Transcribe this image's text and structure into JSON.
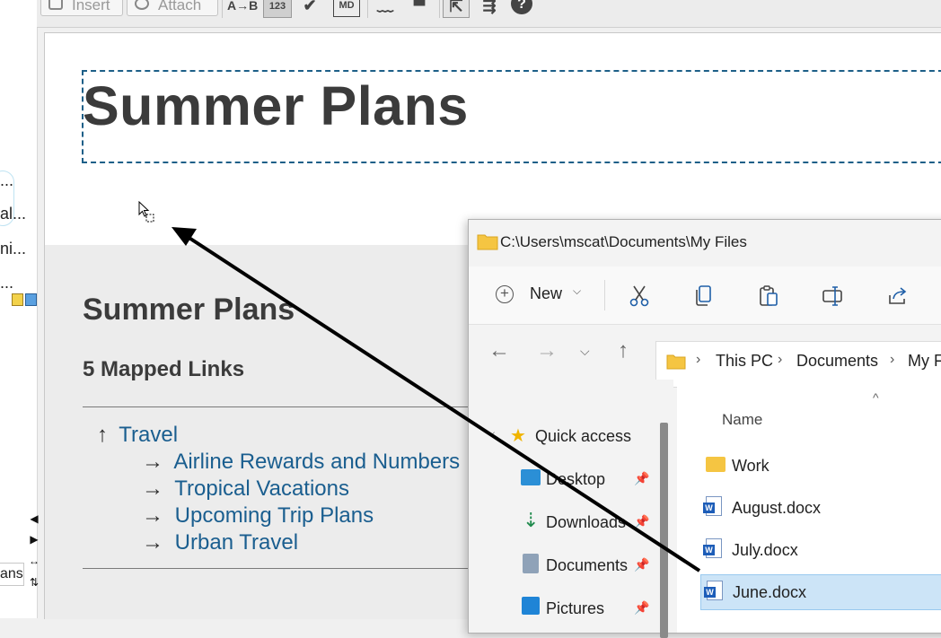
{
  "toolbar": {
    "insert_label": "Insert",
    "attach_label": "Attach",
    "icons": [
      "a-to-b-icon",
      "numbered-icon",
      "check-icon",
      "markdown-icon",
      "mustache-icon",
      "print-icon",
      "export-icon",
      "collapse-icon",
      "help-icon"
    ],
    "glyphs": {
      "a_to_b": "A→B",
      "numbered": "123",
      "check": "✔",
      "markdown": "MD",
      "mustache": "﹏",
      "print": "▀",
      "export": "⇱",
      "collapse": "⇶",
      "help": "?"
    }
  },
  "outline": {
    "items": [
      "...",
      "al...",
      "ni...",
      "..."
    ],
    "bottom_tab": "ans"
  },
  "document": {
    "title": "Summer Plans",
    "export_title": "Summer Plans",
    "mapped_count": "5 Mapped Links",
    "parent_arrow": "↑",
    "parent_link": "Travel",
    "child_arrow": "→",
    "links": [
      "Airline Rewards and Numbers",
      "Tropical Vacations",
      "Upcoming Trip Plans",
      "Urban Travel"
    ]
  },
  "explorer": {
    "title": "C:\\Users\\mscat\\Documents\\My Files",
    "new_label": "New",
    "breadcrumbs": [
      "This PC",
      "Documents",
      "My F"
    ],
    "column_name": "Name",
    "nav": {
      "quick_access": "Quick access",
      "items": [
        {
          "label": "Desktop",
          "icon": "desktop-icon"
        },
        {
          "label": "Downloads",
          "icon": "download-icon"
        },
        {
          "label": "Documents",
          "icon": "documents-icon"
        },
        {
          "label": "Pictures",
          "icon": "pictures-icon"
        }
      ]
    },
    "files": [
      {
        "name": "Work",
        "type": "folder"
      },
      {
        "name": "August.docx",
        "type": "docx"
      },
      {
        "name": "July.docx",
        "type": "docx"
      },
      {
        "name": "June.docx",
        "type": "docx",
        "selected": true
      }
    ]
  },
  "colors": {
    "accent_link": "#1a5e8f",
    "title_border": "#1d5f88",
    "selection": "#cce4f7",
    "folder": "#f5c542",
    "word_blue": "#1d5db8"
  }
}
